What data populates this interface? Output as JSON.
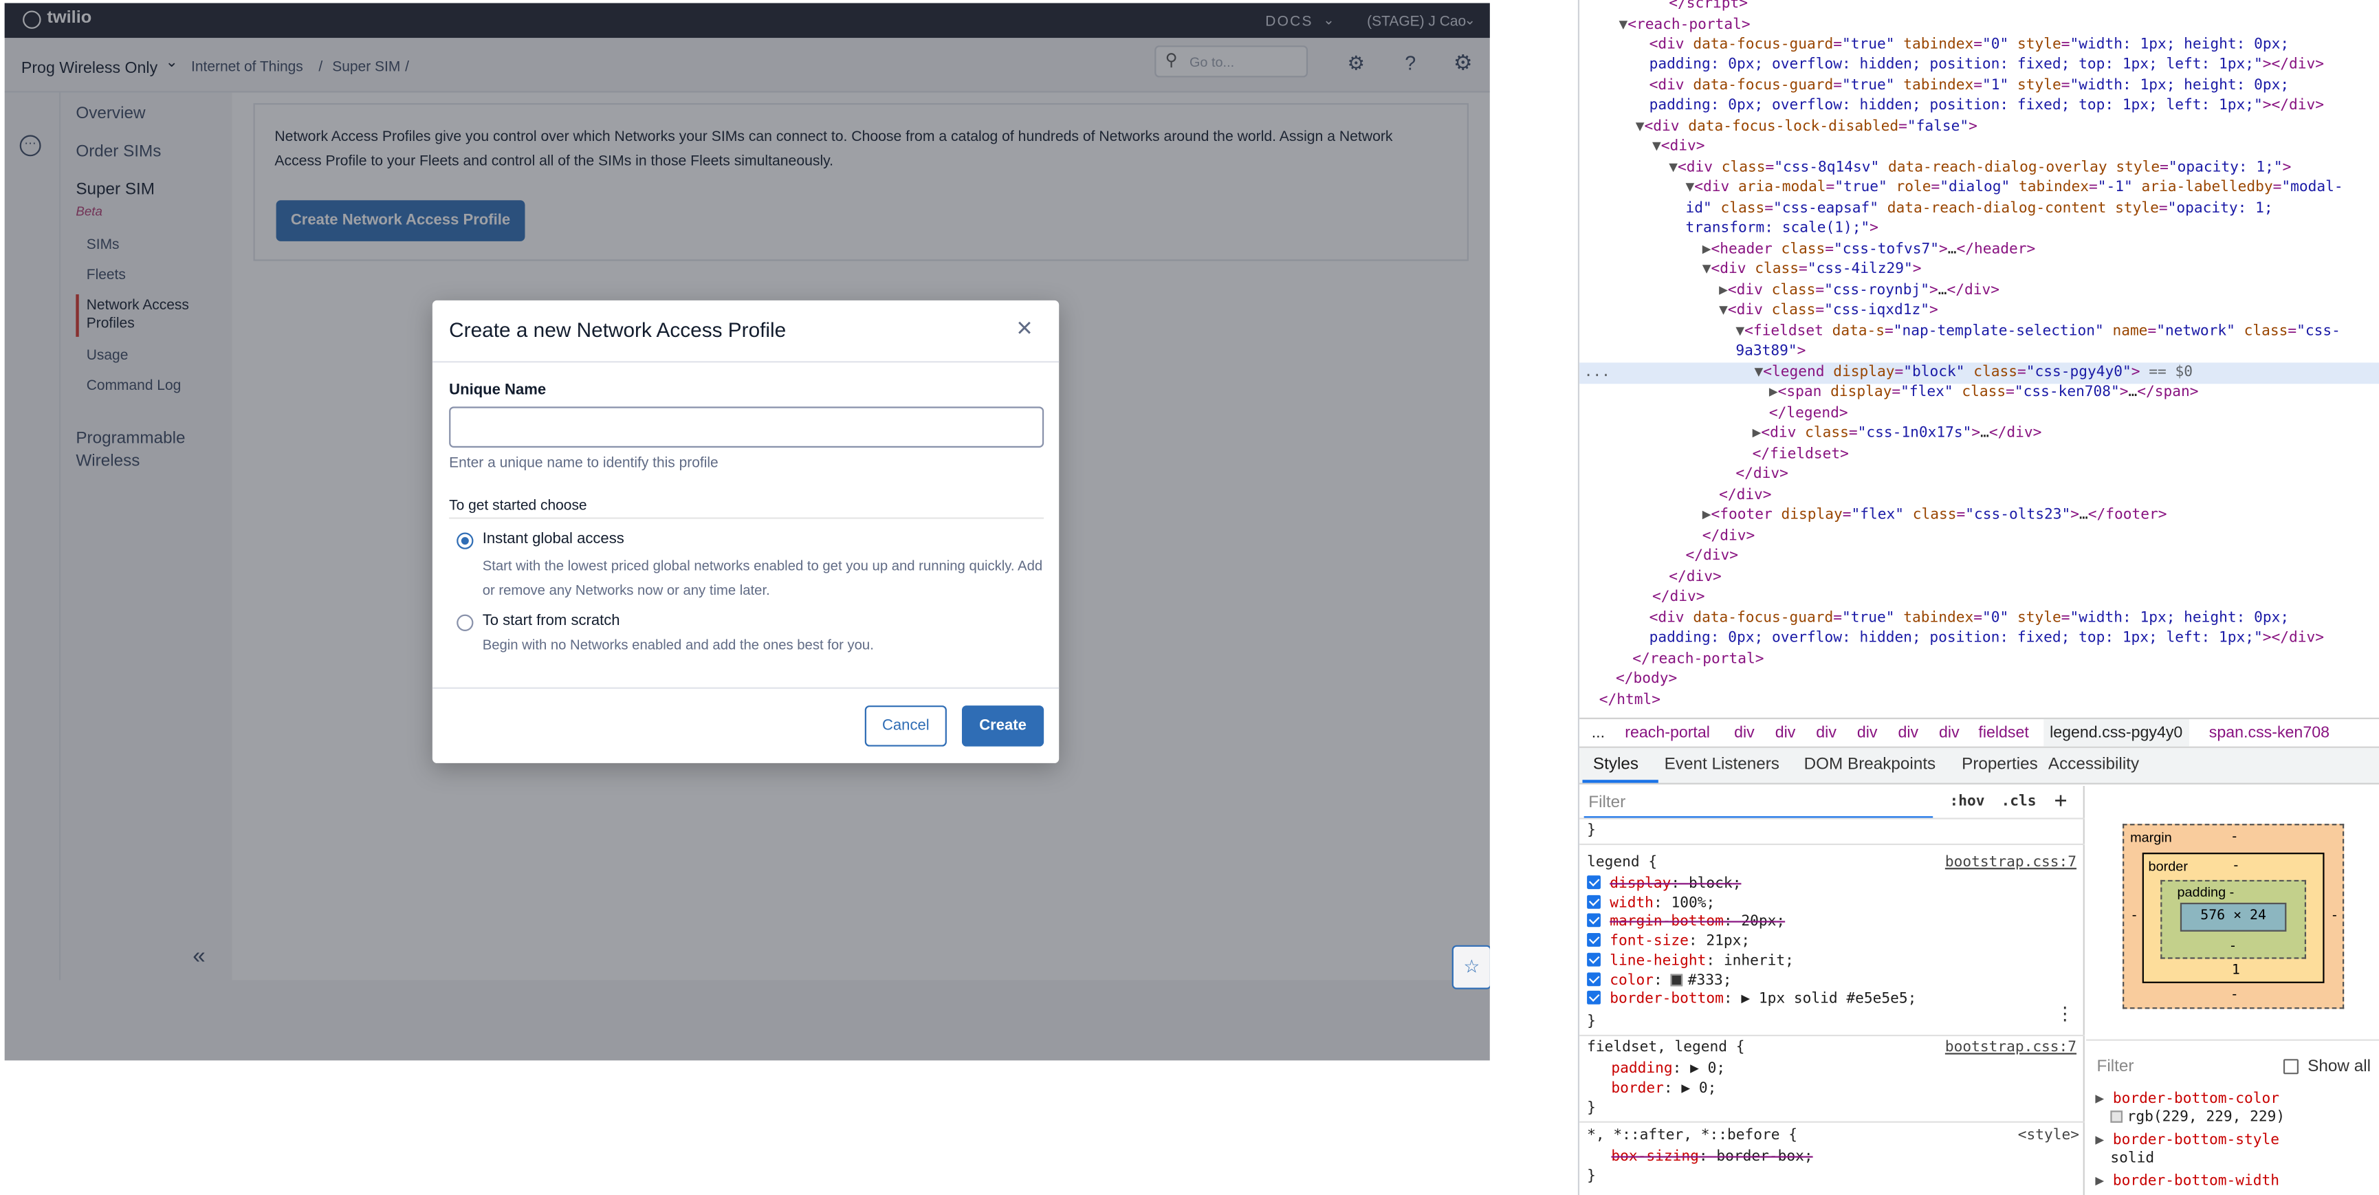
{
  "topbar": {
    "brand": "twilio",
    "docs": "DOCS",
    "account": "(STAGE) J Cao"
  },
  "subbar": {
    "project": "Prog Wireless Only",
    "crumb1": "Internet of Things",
    "sep1": "/",
    "crumb2": "Super SIM",
    "sep2": "/",
    "search_placeholder": "Go to..."
  },
  "sidebar": {
    "items": [
      "Overview",
      "Order SIMs"
    ],
    "section_title": "Super SIM",
    "section_badge": "Beta",
    "subitems": [
      "SIMs",
      "Fleets",
      "Network Access Profiles",
      "Usage",
      "Command Log"
    ],
    "programmable": "Programmable Wireless",
    "collapse": "«"
  },
  "content": {
    "intro": "Network Access Profiles give you control over which Networks your SIMs can connect to. Choose from a catalog of hundreds of Networks around the world. Assign a Network Access Profile to your Fleets and control all of the SIMs in those Fleets simultaneously.",
    "create_button": "Create Network Access Profile"
  },
  "modal": {
    "title": "Create a new Network Access Profile",
    "close": "×",
    "name_label": "Unique Name",
    "name_value": "",
    "name_help": "Enter a unique name to identify this profile",
    "choose_legend": "To get started choose",
    "options": [
      {
        "label": "Instant global access",
        "desc": "Start with the lowest priced global networks enabled to get you up and running quickly. Add or remove any Networks now or any time later.",
        "checked": true
      },
      {
        "label": "To start from scratch",
        "desc": "Begin with no Networks enabled and add the ones best for you.",
        "checked": false
      }
    ],
    "cancel": "Cancel",
    "create": "Create"
  },
  "devtools": {
    "breadcrumbs": [
      "...",
      "reach-portal",
      "div",
      "div",
      "div",
      "div",
      "div",
      "div",
      "fieldset",
      "legend.css-pgy4y0",
      "span.css-ken708"
    ],
    "tabs": [
      "Styles",
      "Event Listeners",
      "DOM Breakpoints",
      "Properties",
      "Accessibility"
    ],
    "filter_placeholder": "Filter",
    "hov": ":hov",
    "cls": ".cls",
    "plus": "+",
    "rule1": {
      "selector": "legend",
      "source": "bootstrap.css:7",
      "decls": [
        {
          "p": "display",
          "v": "block",
          "struck": true
        },
        {
          "p": "width",
          "v": "100%",
          "struck": false
        },
        {
          "p": "margin-bottom",
          "v": "20px",
          "struck": true
        },
        {
          "p": "font-size",
          "v": "21px",
          "struck": false
        },
        {
          "p": "line-height",
          "v": "inherit",
          "struck": false
        },
        {
          "p": "color",
          "v": "#333",
          "struck": false
        },
        {
          "p": "border-bottom",
          "v": "1px solid #e5e5e5",
          "struck": false
        }
      ]
    },
    "rule2": {
      "selector": "fieldset, legend",
      "source": "bootstrap.css:7",
      "decls": [
        {
          "p": "padding",
          "v": "0"
        },
        {
          "p": "border",
          "v": "0"
        }
      ]
    },
    "rule3": {
      "selector": "*, *::after, *::before",
      "source": "<style>",
      "decls": [
        {
          "p": "box-sizing",
          "v": "border-box"
        }
      ]
    },
    "boxmodel": {
      "margin": "margin",
      "margin_val": "-",
      "border": "border",
      "border_val": "-",
      "padding": "padding -",
      "content": "576 × 24",
      "dash": "-",
      "border_bottom_val": "1"
    },
    "computed_filter": "Filter",
    "show_all": "Show all",
    "computed": [
      {
        "p": "border-bottom-color",
        "v": "rgb(229, 229, 229)"
      },
      {
        "p": "border-bottom-style",
        "v": "solid"
      },
      {
        "p": "border-bottom-width",
        "v": ""
      }
    ],
    "equals": "== $0",
    "dots": "...",
    "colors": {
      "selected_row": "#dfe9f8",
      "tag": "#881280",
      "attr_name": "#994500",
      "attr_value": "#1a1aa6"
    }
  },
  "colors": {
    "brand_blue": "#2f6db5",
    "topbar": "#1f2330",
    "active_nav": "#d6332b"
  }
}
